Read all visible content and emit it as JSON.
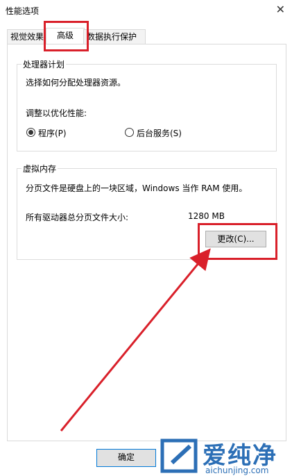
{
  "window": {
    "title": "性能选项"
  },
  "tabs": [
    {
      "label": "视觉效果"
    },
    {
      "label": "高级"
    },
    {
      "label": "数据执行保护"
    }
  ],
  "processor_group": {
    "title": "处理器计划",
    "description": "选择如何分配处理器资源。",
    "optimize_label": "调整以优化性能:",
    "options": [
      {
        "label": "程序(P)",
        "checked": true
      },
      {
        "label": "后台服务(S)",
        "checked": false
      }
    ]
  },
  "virtual_memory": {
    "title": "虚拟内存",
    "description": "分页文件是硬盘上的一块区域，Windows 当作 RAM 使用。",
    "total_label": "所有驱动器总分页文件大小:",
    "total_value": "1280 MB",
    "change_button": "更改(C)..."
  },
  "footer": {
    "ok_button": "确定"
  },
  "watermark": {
    "brand": "爱纯净",
    "url": "aichunjing.com"
  },
  "colors": {
    "highlight": "#d9202a",
    "brand": "#2c6fb6"
  }
}
